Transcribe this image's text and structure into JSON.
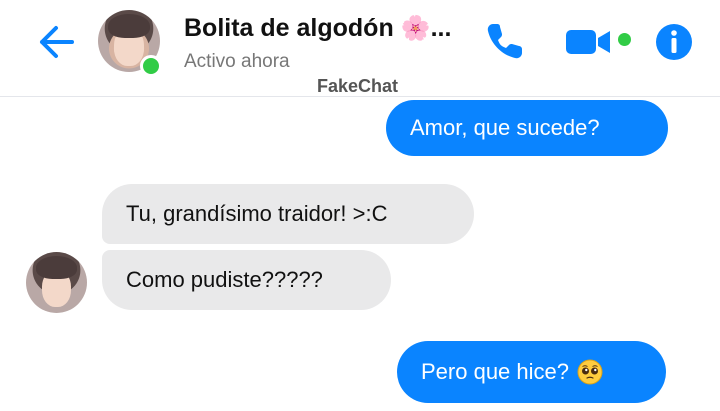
{
  "header": {
    "contact_name": "Bolita de algodón",
    "contact_name_emoji": "🌸",
    "ellipsis": "...",
    "status": "Activo ahora",
    "watermark": "FakeChat"
  },
  "icons": {
    "back": "arrow-left-icon",
    "phone": "phone-icon",
    "video": "video-camera-icon",
    "info": "info-icon",
    "emoji": "pleading-face-emoji-icon"
  },
  "colors": {
    "accent": "#0a84ff",
    "online": "#31cc46",
    "incoming_bubble": "#e9e9ea"
  },
  "messages": [
    {
      "text": "Amor, que sucede?",
      "direction": "outgoing"
    },
    {
      "text": "Tu, grandísimo traidor! >:C",
      "direction": "incoming"
    },
    {
      "text": "Como pudiste?????",
      "direction": "incoming"
    },
    {
      "text": "Pero que hice?",
      "direction": "outgoing",
      "emoji": "🥺"
    }
  ]
}
